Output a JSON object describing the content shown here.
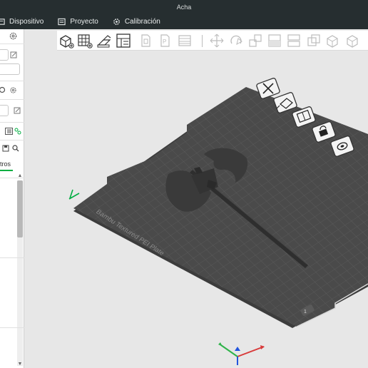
{
  "window": {
    "title": "Acha"
  },
  "menu": {
    "items": [
      {
        "label": "Dispositivo",
        "icon": "device-icon"
      },
      {
        "label": "Proyecto",
        "icon": "project-icon"
      },
      {
        "label": "Calibración",
        "icon": "calibration-icon"
      }
    ]
  },
  "left_panel": {
    "tab_label": "tros",
    "accent_color": "#00ae42"
  },
  "toolbar": {
    "buttons": [
      "add-object-icon",
      "arrange-grid-icon",
      "auto-orient-icon",
      "slice-plate-icon",
      "split-objects-icon",
      "split-parts-icon",
      "layers-icon",
      "move-icon",
      "rotate-icon",
      "scale-icon",
      "place-on-face-icon",
      "cut-icon",
      "boolean-icon",
      "support-paint-icon"
    ]
  },
  "plate": {
    "label": "Bambu Textured PEI Plate",
    "plate_number": "1",
    "colors": {
      "plate": "#4a4a4a",
      "grid": "#5c5c5c",
      "model": "#3a3a3a",
      "accent": "#00ae42"
    }
  }
}
